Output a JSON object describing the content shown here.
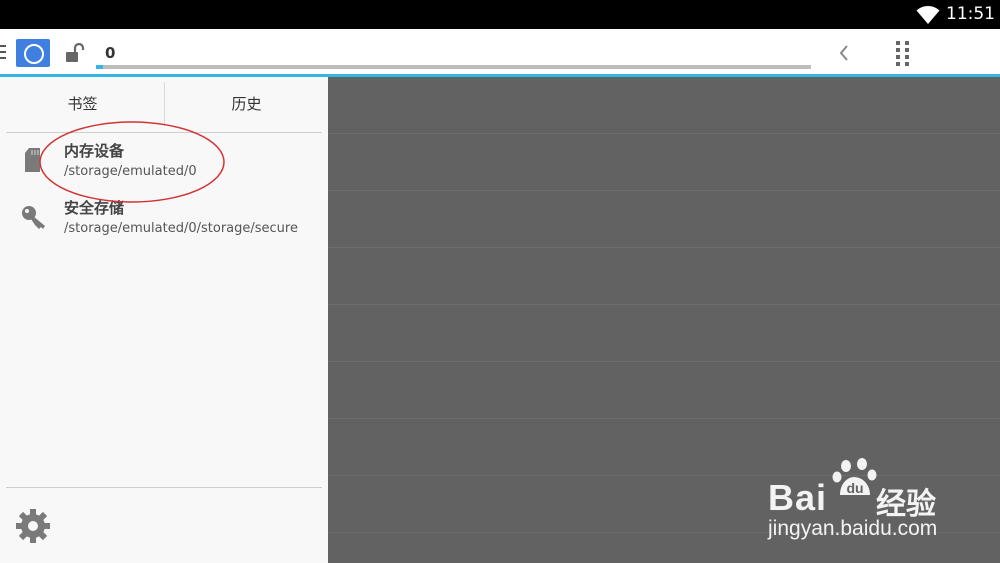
{
  "status_bar": {
    "time": "11:51"
  },
  "toolbar": {
    "path": "0",
    "progress": 0.01
  },
  "tabs": {
    "bookmarks": "书签",
    "history": "历史"
  },
  "locations": [
    {
      "title": "内存设备",
      "path": "/storage/emulated/0",
      "icon": "sd-card-icon"
    },
    {
      "title": "安全存储",
      "path": "/storage/emulated/0/storage/secure",
      "icon": "key-icon"
    }
  ],
  "watermark": {
    "brand": "Bai",
    "brand_cn": "经验",
    "url": "jingyan.baidu.com"
  },
  "colors": {
    "accent": "#33b5e5",
    "button": "#3f7fe0",
    "annotation": "#d33333"
  }
}
